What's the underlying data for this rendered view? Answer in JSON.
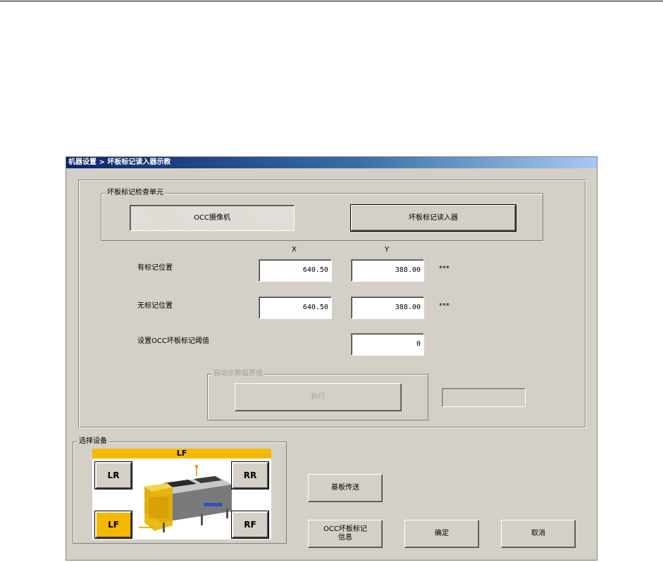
{
  "window": {
    "title": "机器设置 > 坏板标记读入器示教"
  },
  "unit_group": {
    "legend": "坏板标记检查单元",
    "occ_camera_button": "OCC摄像机",
    "bad_mark_reader_button": "坏板标记读入器"
  },
  "positions": {
    "col_x": "X",
    "col_y": "Y",
    "with_mark": {
      "label": "有标记位置",
      "x": "640.50",
      "y": "388.00",
      "suffix": "***"
    },
    "without_mark": {
      "label": "无标记位置",
      "x": "640.50",
      "y": "388.00",
      "suffix": "***"
    },
    "threshold": {
      "label": "设置OCC坏板标记阈值",
      "value": "0"
    }
  },
  "auto_teach": {
    "legend": "自动示教临界值",
    "execute_button": "执行",
    "result_value": ""
  },
  "device_select": {
    "legend": "选择设备",
    "current": "LF",
    "buttons": {
      "lr": "LR",
      "rr": "RR",
      "lf": "LF",
      "rf": "RF"
    },
    "active_color": "#f5b800"
  },
  "actions": {
    "board_transfer": "基板传送",
    "occ_info_line1": "OCC坏板标记",
    "occ_info_line2": "信息",
    "ok": "确定",
    "cancel": "取消"
  }
}
